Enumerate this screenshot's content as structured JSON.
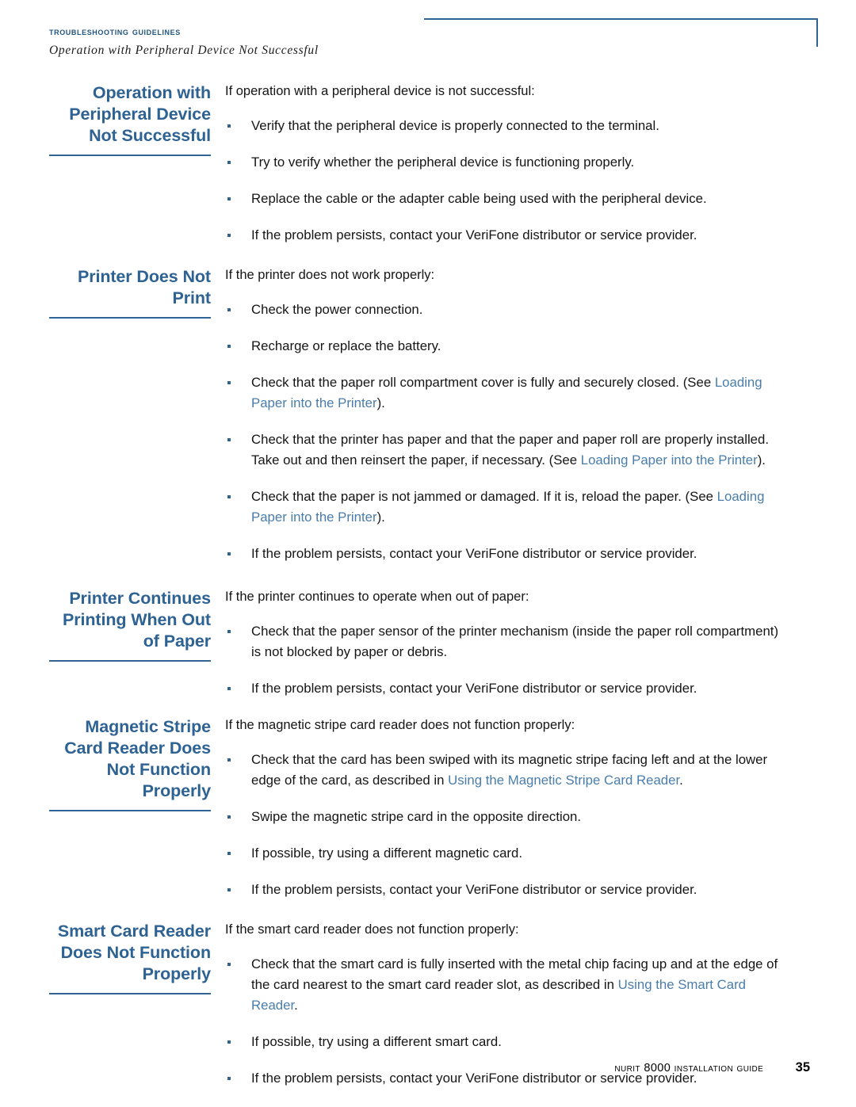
{
  "header": {
    "running_title": "Troubleshooting Guidelines",
    "running_subtitle": "Operation with Peripheral Device Not Successful"
  },
  "colors": {
    "heading_blue": "#2d6293",
    "rule_blue": "#2f6596",
    "xref_blue": "#4a7daa",
    "body_black": "#151515"
  },
  "sections": [
    {
      "heading": "Operation with Peripheral Device Not Successful",
      "intro": "If operation with a peripheral device is not successful:",
      "bullets": [
        {
          "parts": [
            {
              "t": "Verify that the peripheral device is properly connected to the terminal.",
              "xref": false
            }
          ]
        },
        {
          "parts": [
            {
              "t": "Try to verify whether the peripheral device is functioning properly.",
              "xref": false
            }
          ]
        },
        {
          "parts": [
            {
              "t": "Replace the cable or the adapter cable being used with the peripheral device.",
              "xref": false
            }
          ]
        },
        {
          "parts": [
            {
              "t": "If the problem persists, contact your VeriFone distributor or service provider.",
              "xref": false
            }
          ]
        }
      ]
    },
    {
      "heading": "Printer Does Not Print",
      "intro": "If the printer does not work properly:",
      "bullets": [
        {
          "parts": [
            {
              "t": "Check the power connection.",
              "xref": false
            }
          ]
        },
        {
          "parts": [
            {
              "t": "Recharge or replace the battery.",
              "xref": false
            }
          ]
        },
        {
          "parts": [
            {
              "t": "Check that the paper roll compartment cover is fully and securely closed. (See ",
              "xref": false
            },
            {
              "t": "Loading Paper into the Printer",
              "xref": true
            },
            {
              "t": ").",
              "xref": false
            }
          ]
        },
        {
          "parts": [
            {
              "t": "Check that the printer has paper and that the paper and paper roll are properly installed. Take out and then reinsert the paper, if necessary. (See ",
              "xref": false
            },
            {
              "t": "Loading Paper into the Printer",
              "xref": true
            },
            {
              "t": ").",
              "xref": false
            }
          ]
        },
        {
          "parts": [
            {
              "t": "Check that the paper is not jammed or damaged. If it is, reload the paper. (See ",
              "xref": false
            },
            {
              "t": "Loading Paper into the Printer",
              "xref": true
            },
            {
              "t": ").",
              "xref": false
            }
          ]
        },
        {
          "parts": [
            {
              "t": "If the problem persists, contact your VeriFone distributor or service provider.",
              "xref": false
            }
          ]
        }
      ]
    },
    {
      "heading": "Printer Continues Printing When Out of Paper",
      "intro": "If the printer continues to operate when out of paper:",
      "bullets": [
        {
          "parts": [
            {
              "t": "Check that the paper sensor of the printer mechanism (inside the paper roll compartment) is not blocked by paper or debris.",
              "xref": false
            }
          ]
        },
        {
          "parts": [
            {
              "t": "If the problem persists, contact your VeriFone distributor or service provider.",
              "xref": false
            }
          ]
        }
      ]
    },
    {
      "heading": "Magnetic Stripe Card Reader Does Not Function Properly",
      "intro": "If the magnetic stripe card reader does not function properly:",
      "bullets": [
        {
          "parts": [
            {
              "t": "Check that the card has been swiped with its magnetic stripe facing left and at the lower edge of the card, as described in ",
              "xref": false
            },
            {
              "t": "Using the Magnetic Stripe Card Reader",
              "xref": true
            },
            {
              "t": ".",
              "xref": false
            }
          ]
        },
        {
          "parts": [
            {
              "t": "Swipe the magnetic stripe card in the opposite direction.",
              "xref": false
            }
          ]
        },
        {
          "parts": [
            {
              "t": "If possible, try using a different magnetic card.",
              "xref": false
            }
          ]
        },
        {
          "parts": [
            {
              "t": "If the problem persists, contact your VeriFone distributor or service provider.",
              "xref": false
            }
          ]
        }
      ]
    },
    {
      "heading": "Smart Card Reader Does Not Function Properly",
      "intro": "If the smart card reader does not function properly:",
      "bullets": [
        {
          "parts": [
            {
              "t": "Check that the smart card is fully inserted with the metal chip facing up and at the edge of the card nearest to the smart card reader slot, as described in ",
              "xref": false
            },
            {
              "t": "Using the Smart Card Reader",
              "xref": true
            },
            {
              "t": ".",
              "xref": false
            }
          ]
        },
        {
          "parts": [
            {
              "t": "If possible, try using a different smart card.",
              "xref": false
            }
          ]
        },
        {
          "parts": [
            {
              "t": "If the problem persists, contact your VeriFone distributor or service provider.",
              "xref": false
            }
          ]
        }
      ]
    }
  ],
  "footer": {
    "guide_title": "NURIT 8000 Installation Guide",
    "page_number": "35"
  }
}
